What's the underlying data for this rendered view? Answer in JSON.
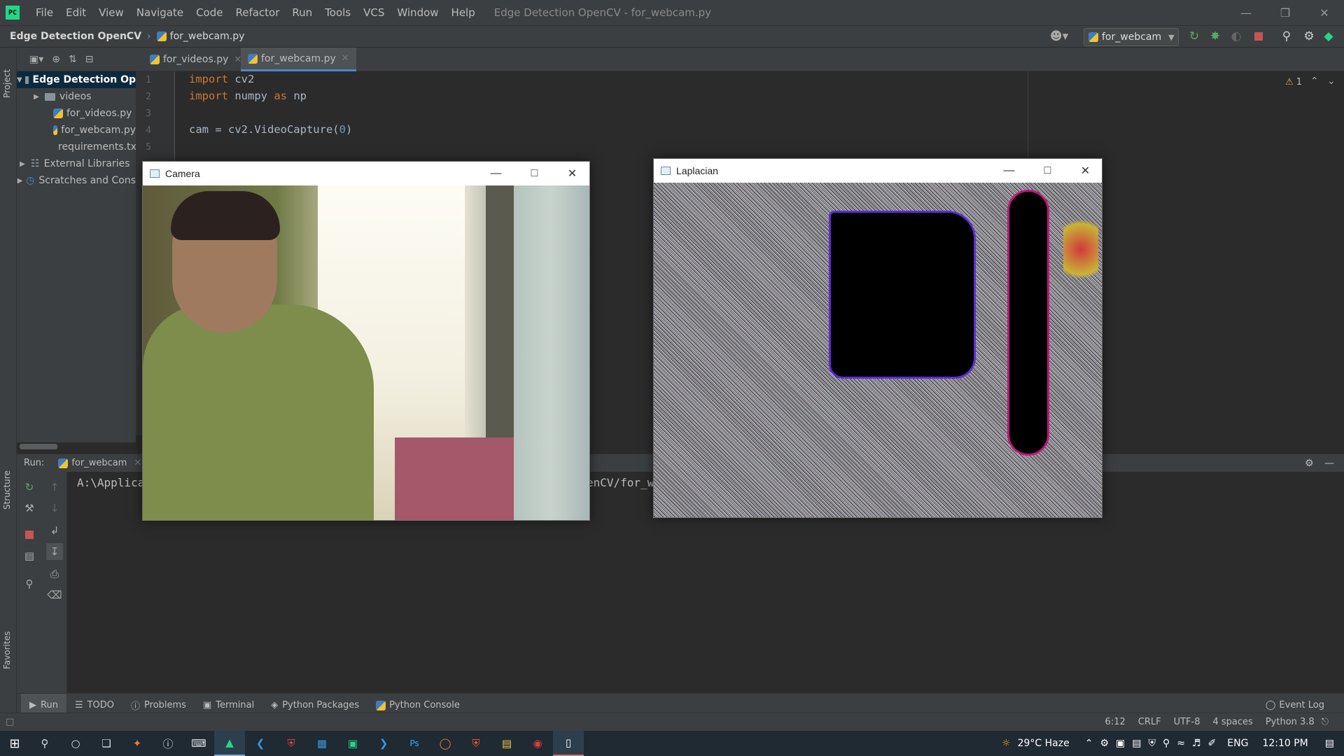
{
  "app": {
    "window_title": "Edge Detection OpenCV - for_webcam.py",
    "menu": [
      "File",
      "Edit",
      "View",
      "Navigate",
      "Code",
      "Refactor",
      "Run",
      "Tools",
      "VCS",
      "Window",
      "Help"
    ]
  },
  "breadcrumb": {
    "project": "Edge Detection OpenCV",
    "file": "for_webcam.py"
  },
  "run_config": {
    "name": "for_webcam"
  },
  "project_tree": {
    "root": "Edge Detection Op",
    "items": [
      {
        "label": "videos",
        "type": "folder"
      },
      {
        "label": "for_videos.py",
        "type": "py"
      },
      {
        "label": "for_webcam.py",
        "type": "py"
      },
      {
        "label": "requirements.tx",
        "type": "txt"
      }
    ],
    "external": "External Libraries",
    "scratches": "Scratches and Cons"
  },
  "side_labels": {
    "project": "Project",
    "structure": "Structure",
    "favorites": "Favorites"
  },
  "editor": {
    "tabs": [
      {
        "label": "for_videos.py",
        "active": false
      },
      {
        "label": "for_webcam.py",
        "active": true
      }
    ],
    "warning_count": "1",
    "line_numbers": [
      "1",
      "2",
      "3",
      "4",
      "5"
    ],
    "code": {
      "l1_kw": "import",
      "l1_mod": " cv2",
      "l2_kw": "import",
      "l2_mod": " numpy ",
      "l2_as": "as",
      "l2_alias": " np",
      "l4_pre": "cam = cv2.VideoCapture(",
      "l4_num": "0",
      "l4_post": ")"
    }
  },
  "run_panel": {
    "label": "Run:",
    "tab": "for_webcam",
    "console_left": "A:\\Applica",
    "console_right": "enCV/for_w"
  },
  "camera_window": {
    "title": "Camera"
  },
  "laplacian_window": {
    "title": "Laplacian"
  },
  "bottom_tabs": [
    "Run",
    "TODO",
    "Problems",
    "Terminal",
    "Python Packages",
    "Python Console"
  ],
  "event_log": "Event Log",
  "status": {
    "position": "6:12",
    "line_sep": "CRLF",
    "encoding": "UTF-8",
    "indent": "4 spaces",
    "interpreter": "Python 3.8"
  },
  "taskbar": {
    "weather": "29°C  Haze",
    "lang": "ENG",
    "time": "12:10 PM"
  },
  "colors": {
    "accent": "#4a88c7",
    "ide_bg": "#2b2b2b",
    "panel": "#3c3f41"
  }
}
